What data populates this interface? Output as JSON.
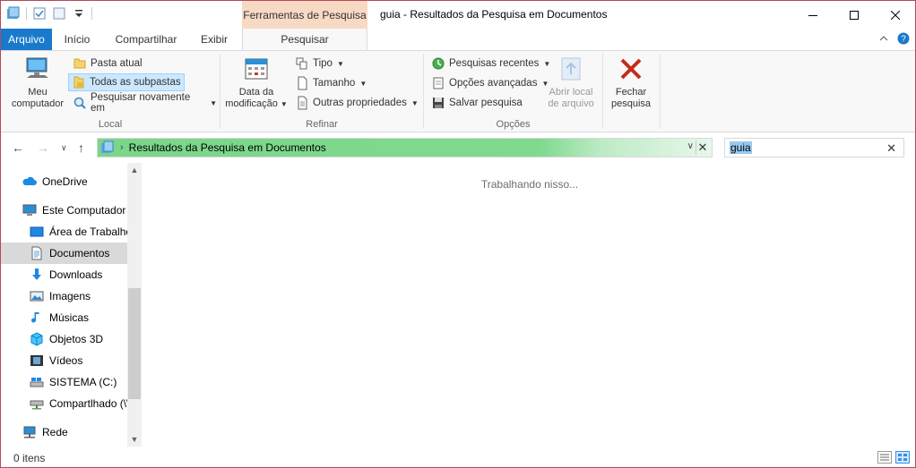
{
  "window": {
    "title": "guia - Resultados da Pesquisa em Documentos",
    "context_tab": "Ferramentas de Pesquisa"
  },
  "tabs": {
    "file": "Arquivo",
    "home": "Início",
    "share": "Compartilhar",
    "view": "Exibir",
    "search": "Pesquisar"
  },
  "ribbon": {
    "local": {
      "label": "Local",
      "computer": [
        "Meu",
        "computador"
      ],
      "current_folder": "Pasta atual",
      "all_subfolders": "Todas as subpastas",
      "search_again": "Pesquisar novamente em"
    },
    "refine": {
      "label": "Refinar",
      "date_modified": [
        "Data da",
        "modificação"
      ],
      "type": "Tipo",
      "size": "Tamanho",
      "other_props": "Outras propriedades"
    },
    "options": {
      "label": "Opções",
      "recent": "Pesquisas recentes",
      "advanced": "Opções avançadas",
      "save": "Salvar pesquisa",
      "open_location": [
        "Abrir local",
        "de arquivo"
      ]
    },
    "close": [
      "Fechar",
      "pesquisa"
    ]
  },
  "address": {
    "path": "Resultados da Pesquisa em Documentos"
  },
  "search": {
    "value": "guia"
  },
  "nav": {
    "items": [
      {
        "label": "OneDrive",
        "icon": "cloud-icon"
      },
      {
        "label": "Este Computador",
        "icon": "computer-icon"
      },
      {
        "label": "Área de Trabalho",
        "icon": "desktop-icon"
      },
      {
        "label": "Documentos",
        "icon": "documents-icon"
      },
      {
        "label": "Downloads",
        "icon": "downloads-icon"
      },
      {
        "label": "Imagens",
        "icon": "pictures-icon"
      },
      {
        "label": "Músicas",
        "icon": "music-icon"
      },
      {
        "label": "Objetos 3D",
        "icon": "3d-objects-icon"
      },
      {
        "label": "Vídeos",
        "icon": "videos-icon"
      },
      {
        "label": "SISTEMA (C:)",
        "icon": "drive-icon"
      },
      {
        "label": "Compartlhado (\\\\",
        "icon": "network-drive-icon"
      },
      {
        "label": "Rede",
        "icon": "network-icon"
      }
    ]
  },
  "content": {
    "status_text": "Trabalhando nisso..."
  },
  "statusbar": {
    "count": "0 itens"
  },
  "colors": {
    "accent": "#1979ca",
    "context_tab": "#f8d9c4",
    "address_progress": "#7fd98f",
    "selection": "#cce8ff",
    "close_red": "#c42b1c"
  }
}
